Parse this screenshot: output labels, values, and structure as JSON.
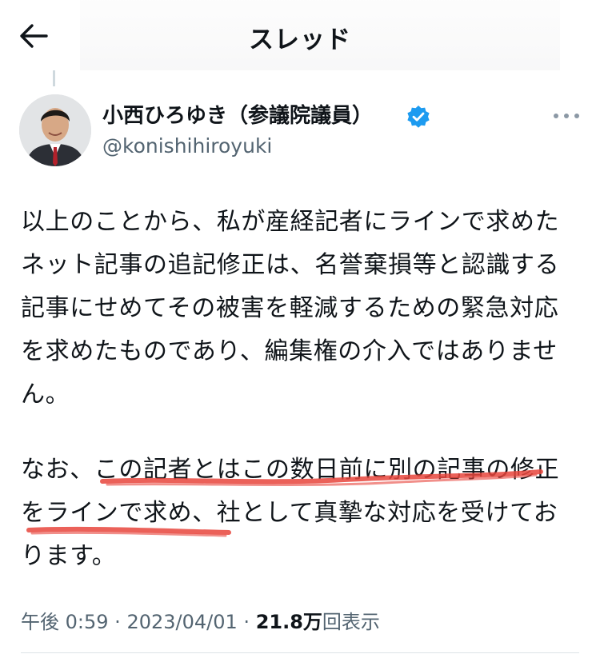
{
  "header": {
    "title": "スレッド"
  },
  "author": {
    "name": "小西ひろゆき（参議院議員）",
    "handle": "@konishihiroyuki"
  },
  "post": {
    "paragraph1": [
      "以上のことから、私が産経記者にラインで求めた",
      "ネット記事の追記修正は、名誉棄損等と認識する",
      "記事にせめてその被害を軽減するための緊急対応",
      "を求めたものであり、編集権の介入ではありませ",
      "ん。"
    ],
    "paragraph2": [
      "なお、この記者とはこの数日前に別の記事の修正",
      "をラインで求め、社として真摯な対応を受けてお",
      "ります。"
    ]
  },
  "meta": {
    "time": "午後 0:59",
    "separator": "·",
    "date": "2023/04/01",
    "views_count": "21.8万",
    "views_label": "回表示"
  },
  "colors": {
    "text": "#0f1419",
    "secondary": "#536471",
    "verified": "#1d9bf0",
    "underline_highlight": "#e8453c"
  },
  "icons": {
    "back": "arrow-left",
    "verified": "verified-badge",
    "more": "more-horizontal"
  }
}
